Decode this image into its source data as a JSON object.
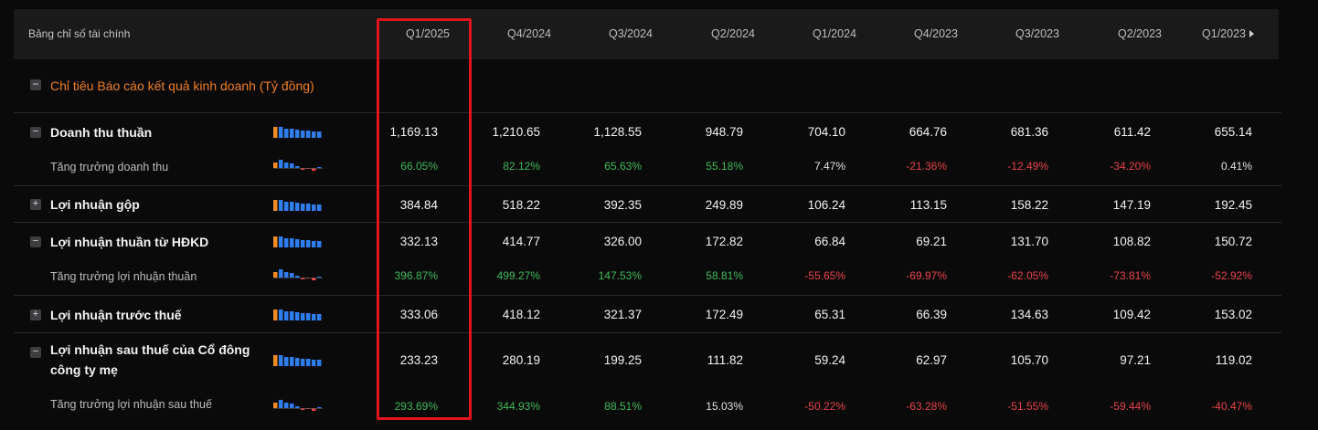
{
  "header": {
    "title": "Bảng chỉ số tài chính",
    "periods": [
      "Q1/2025",
      "Q4/2024",
      "Q3/2024",
      "Q2/2024",
      "Q1/2024",
      "Q4/2023",
      "Q3/2023",
      "Q2/2023",
      "Q1/2023"
    ]
  },
  "section": {
    "title": "Chỉ tiêu Báo cáo kết quả kinh doanh (Tỷ đồng)",
    "toggle": "−"
  },
  "rows": [
    {
      "label": "Doanh thu thuần",
      "toggle": "−",
      "values": [
        "1,169.13",
        "1,210.65",
        "1,128.55",
        "948.79",
        "704.10",
        "664.76",
        "681.36",
        "611.42",
        "655.14"
      ]
    },
    {
      "label": "Tăng trưởng doanh thu",
      "values": [
        "66.05%",
        "82.12%",
        "65.63%",
        "55.18%",
        "7.47%",
        "-21.36%",
        "-12.49%",
        "-34.20%",
        "0.41%"
      ],
      "tones": [
        "pos",
        "pos",
        "pos",
        "pos",
        "neu",
        "neg",
        "neg",
        "neg",
        "neu"
      ]
    },
    {
      "label": "Lợi nhuận gộp",
      "toggle": "+",
      "values": [
        "384.84",
        "518.22",
        "392.35",
        "249.89",
        "106.24",
        "113.15",
        "158.22",
        "147.19",
        "192.45"
      ]
    },
    {
      "label": "Lợi nhuận thuần từ HĐKD",
      "toggle": "−",
      "values": [
        "332.13",
        "414.77",
        "326.00",
        "172.82",
        "66.84",
        "69.21",
        "131.70",
        "108.82",
        "150.72"
      ]
    },
    {
      "label": "Tăng trưởng lợi nhuận thuần",
      "values": [
        "396.87%",
        "499.27%",
        "147.53%",
        "58.81%",
        "-55.65%",
        "-69.97%",
        "-62.05%",
        "-73.81%",
        "-52.92%"
      ],
      "tones": [
        "pos",
        "pos",
        "pos",
        "pos",
        "neg",
        "neg",
        "neg",
        "neg",
        "neg"
      ]
    },
    {
      "label": "Lợi nhuận trước thuế",
      "toggle": "+",
      "values": [
        "333.06",
        "418.12",
        "321.37",
        "172.49",
        "65.31",
        "66.39",
        "134.63",
        "109.42",
        "153.02"
      ]
    },
    {
      "label_line1": "Lợi nhuận sau thuế của Cổ đông",
      "label_line2": "công ty mẹ",
      "toggle": "−",
      "values": [
        "233.23",
        "280.19",
        "199.25",
        "111.82",
        "59.24",
        "62.97",
        "105.70",
        "97.21",
        "119.02"
      ]
    },
    {
      "label": "Tăng trưởng lợi nhuận sau thuế",
      "values": [
        "293.69%",
        "344.93%",
        "88.51%",
        "15.03%",
        "-50.22%",
        "-63.28%",
        "-51.55%",
        "-59.44%",
        "-40.47%"
      ],
      "tones": [
        "pos",
        "pos",
        "pos",
        "neu",
        "neg",
        "neg",
        "neg",
        "neg",
        "neg"
      ]
    }
  ],
  "colors": {
    "accent_orange": "#f07f22",
    "bar_blue": "#2f7ef0",
    "positive": "#3fba5b",
    "negative": "#e8434a",
    "highlight_box": "#e0151c"
  }
}
